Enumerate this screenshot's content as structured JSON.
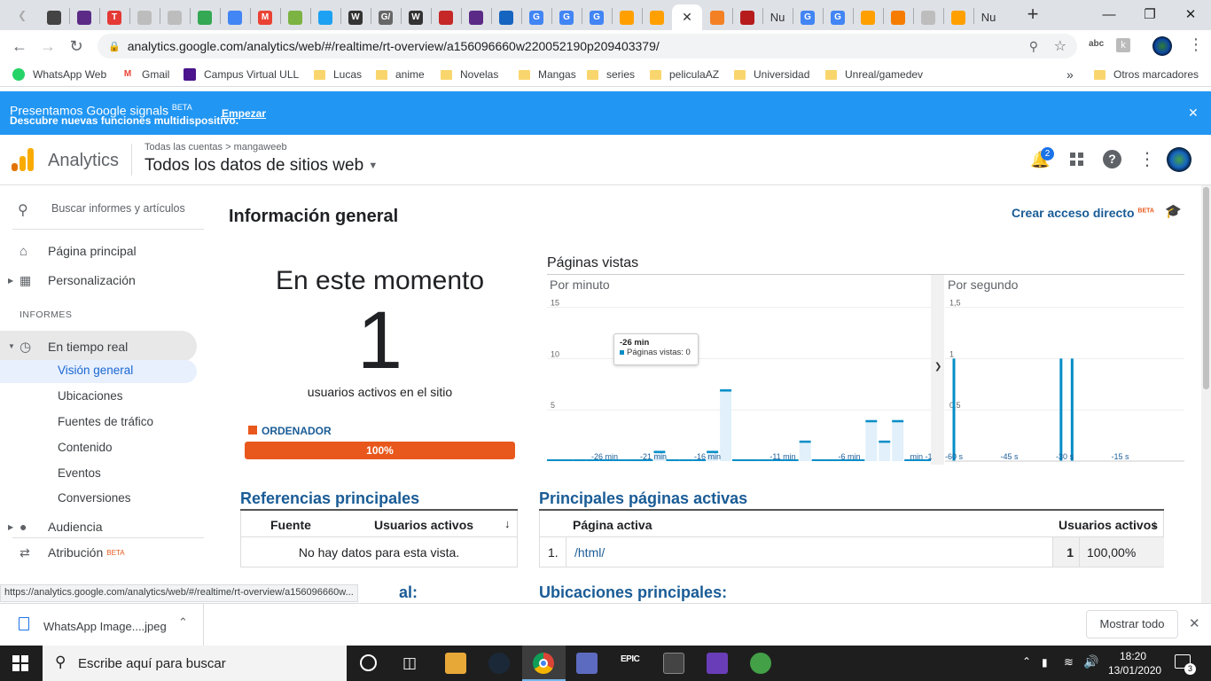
{
  "browser": {
    "tabs": [
      {
        "icon": "bar-chart-icon",
        "label": "",
        "color": "#444"
      },
      {
        "icon": "u-logo-icon",
        "label": "",
        "color": "#5b2a86"
      },
      {
        "icon": "t-logo-icon",
        "label": "T",
        "color": "#e53935"
      },
      {
        "icon": "circle-icon",
        "label": "",
        "color": "#bdbdbd"
      },
      {
        "icon": "circle-icon",
        "label": "",
        "color": "#bdbdbd"
      },
      {
        "icon": "drive-icon",
        "label": "",
        "color": "#34a853"
      },
      {
        "icon": "docs-icon",
        "label": "",
        "color": "#4285f4"
      },
      {
        "icon": "gmail-icon",
        "label": "M",
        "color": "#ea4335"
      },
      {
        "icon": "leaf-icon",
        "label": "",
        "color": "#7cb342"
      },
      {
        "icon": "twitter-icon",
        "label": "",
        "color": "#1da1f2"
      },
      {
        "icon": "wikipedia-icon",
        "label": "W",
        "color": "#333"
      },
      {
        "icon": "g-slash-icon",
        "label": "G/",
        "color": "#666"
      },
      {
        "icon": "wikipedia-icon",
        "label": "W",
        "color": "#333"
      },
      {
        "icon": "flag-icon",
        "label": "",
        "color": "#c62828"
      },
      {
        "icon": "u-logo-icon",
        "label": "",
        "color": "#5b2a86"
      },
      {
        "icon": "doc-blue-icon",
        "label": "",
        "color": "#1565c0"
      },
      {
        "icon": "google-icon",
        "label": "G",
        "color": "#4285f4"
      },
      {
        "icon": "google-icon",
        "label": "G",
        "color": "#4285f4"
      },
      {
        "icon": "google-icon",
        "label": "G",
        "color": "#4285f4"
      },
      {
        "icon": "firebase-icon",
        "label": "",
        "color": "#ffa000"
      },
      {
        "icon": "firebase-icon",
        "label": "",
        "color": "#ffa000"
      },
      {
        "icon": "close-icon",
        "label": "",
        "color": "#fff",
        "active": true
      },
      {
        "icon": "stack-icon",
        "label": "",
        "color": "#f48024"
      },
      {
        "icon": "n-red-icon",
        "label": "",
        "color": "#b71c1c"
      },
      {
        "icon": "text-tab",
        "label": "Nu",
        "color": "#333"
      },
      {
        "icon": "google-icon",
        "label": "G",
        "color": "#4285f4"
      },
      {
        "icon": "google-icon",
        "label": "G",
        "color": "#4285f4"
      },
      {
        "icon": "firebase-icon",
        "label": "",
        "color": "#ffa000"
      },
      {
        "icon": "analytics-icon",
        "label": "",
        "color": "#f57c00"
      },
      {
        "icon": "circle-icon",
        "label": "",
        "color": "#bdbdbd"
      },
      {
        "icon": "firebase-icon",
        "label": "",
        "color": "#ffa000"
      },
      {
        "icon": "text-tab",
        "label": "Nu",
        "color": "#333"
      }
    ],
    "new_tab": "+",
    "url": "analytics.google.com/analytics/web/#/realtime/rt-overview/a156096660w220052190p209403379/",
    "bookmarks": [
      {
        "label": "WhatsApp Web",
        "type": "whatsapp"
      },
      {
        "label": "Gmail",
        "type": "gmail"
      },
      {
        "label": "Campus Virtual ULL",
        "type": "ull"
      },
      {
        "label": "Lucas",
        "type": "folder"
      },
      {
        "label": "anime",
        "type": "folder"
      },
      {
        "label": "Novelas",
        "type": "folder"
      },
      {
        "label": "Mangas",
        "type": "folder"
      },
      {
        "label": "series",
        "type": "folder"
      },
      {
        "label": "peliculaAZ",
        "type": "folder"
      },
      {
        "label": "Universidad",
        "type": "folder"
      },
      {
        "label": "Unreal/gamedev",
        "type": "folder"
      }
    ],
    "bookmarks_more": "»",
    "other_bookmarks": "Otros marcadores",
    "status_url": "https://analytics.google.com/analytics/web/#/realtime/rt-overview/a156096660w..."
  },
  "banner": {
    "title": "Presentamos Google signals",
    "beta": "BETA",
    "subtitle": "Descubre nuevas funciones multidispositivo.",
    "link": "Empezar",
    "close": "✕"
  },
  "ga": {
    "product": "Analytics",
    "breadcrumb_accounts": "Todas las cuentas",
    "breadcrumb_sep": ">",
    "breadcrumb_property": "mangaweeb",
    "view_name": "Todos los datos de sitios web",
    "notifications": "2"
  },
  "sidebar": {
    "search_placeholder": "Buscar informes y artículos",
    "home": "Página principal",
    "customization": "Personalización",
    "section": "INFORMES",
    "realtime": "En tiempo real",
    "realtime_items": [
      "Visión general",
      "Ubicaciones",
      "Fuentes de tráfico",
      "Contenido",
      "Eventos",
      "Conversiones"
    ],
    "audience": "Audiencia",
    "attribution": "Atribución",
    "attribution_beta": "BETA"
  },
  "main": {
    "title": "Información general",
    "shortcut": "Crear acceso directo",
    "shortcut_beta": "BETA",
    "now_label": "En este momento",
    "active_users": "1",
    "active_users_label": "usuarios activos en el sitio",
    "device_label": "ORDENADOR",
    "device_percent": "100%",
    "device_fraction": 1.0,
    "pageviews_title": "Páginas vistas",
    "per_minute": "Por minuto",
    "per_second": "Por segundo",
    "tooltip_time": "-26 min",
    "tooltip_value": "Páginas vistas: 0",
    "referrals_title": "Referencias principales",
    "referrals_col_source": "Fuente",
    "referrals_col_users": "Usuarios activos",
    "referrals_empty": "No hay datos para esta vista.",
    "pages_title": "Principales páginas activas",
    "pages_col_page": "Página activa",
    "pages_col_users": "Usuarios activos",
    "pages_rows": [
      {
        "idx": "1.",
        "page": "/html/",
        "users": "1",
        "pct": "100,00%"
      }
    ],
    "locations_title": "Ubicaciones principales:",
    "partial_label": "al:"
  },
  "chart_data": [
    {
      "type": "bar",
      "title": "Por minuto",
      "ylim": [
        0,
        16
      ],
      "y_ticks": [
        "15",
        "10",
        "5"
      ],
      "x_ticks": [
        "-26 min",
        "-21 min",
        "-16 min",
        "-11 min",
        "-6 min",
        "min -1"
      ],
      "x": [
        -29,
        -28,
        -27,
        -26,
        -25,
        -24,
        -23,
        -22,
        -21,
        -20,
        -19,
        -18,
        -17,
        -16,
        -15,
        -14,
        -13,
        -12,
        -11,
        -10,
        -9,
        -8,
        -7,
        -6,
        -5,
        -4,
        -3,
        -2,
        -1
      ],
      "values": [
        0,
        0,
        0,
        0,
        0,
        0,
        0,
        0,
        1,
        0,
        0,
        0,
        1,
        7,
        0,
        0,
        0,
        0,
        0,
        2,
        0,
        0,
        0,
        0,
        4,
        2,
        4,
        0,
        0
      ]
    },
    {
      "type": "bar",
      "title": "Por segundo",
      "ylim": [
        0,
        1.5
      ],
      "y_ticks": [
        "1,5",
        "1",
        "0,5"
      ],
      "x_ticks": [
        "-60 s",
        "-45 s",
        "-30 s",
        "-15 s"
      ],
      "x": [
        -60,
        -31,
        -28
      ],
      "values": [
        1,
        1,
        1
      ]
    }
  ],
  "downloads": {
    "file": "WhatsApp Image....jpeg",
    "show_all": "Mostrar todo"
  },
  "taskbar": {
    "search_placeholder": "Escribe aquí para buscar",
    "time": "18:20",
    "date": "13/01/2020",
    "notif_count": "3"
  },
  "colors": {
    "accent_blue": "#1a73e8",
    "banner_blue": "#2196f3",
    "device_orange": "#e8581c",
    "chart_blue": "#058dc7",
    "title_blue": "#1a5c96"
  }
}
